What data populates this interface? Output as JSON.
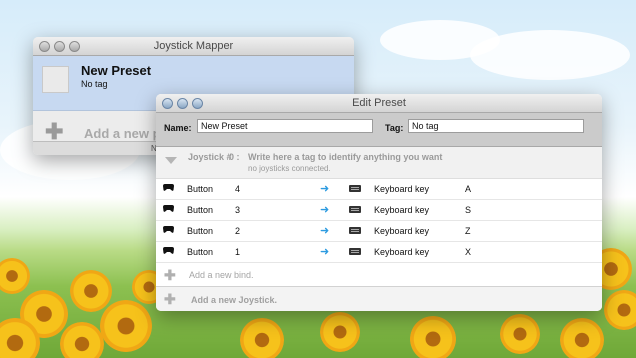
{
  "back_window": {
    "title": "Joystick Mapper",
    "preset": {
      "name": "New Preset",
      "tag": "No tag"
    },
    "add_preset_label": "Add a new p",
    "footer_text": "N"
  },
  "edit_window": {
    "title": "Edit Preset",
    "name_label": "Name:",
    "name_value": "New Preset",
    "tag_label": "Tag:",
    "tag_value": "No tag",
    "joystick": {
      "label": "Joystick #",
      "number": "0 :",
      "tag_placeholder": "Write here a tag to identify anything you want",
      "status": "no joysticks connected."
    },
    "binds": [
      {
        "input_type": "Button",
        "input_number": "4",
        "output_type": "Keyboard key",
        "key": "A"
      },
      {
        "input_type": "Button",
        "input_number": "3",
        "output_type": "Keyboard key",
        "key": "S"
      },
      {
        "input_type": "Button",
        "input_number": "2",
        "output_type": "Keyboard key",
        "key": "Z"
      },
      {
        "input_type": "Button",
        "input_number": "1",
        "output_type": "Keyboard key",
        "key": "X"
      }
    ],
    "add_bind_label": "Add a new bind.",
    "add_joystick_label": "Add a new Joystick."
  },
  "colors": {
    "accent": "#2d9be0",
    "selection": "#c7d9f1"
  }
}
